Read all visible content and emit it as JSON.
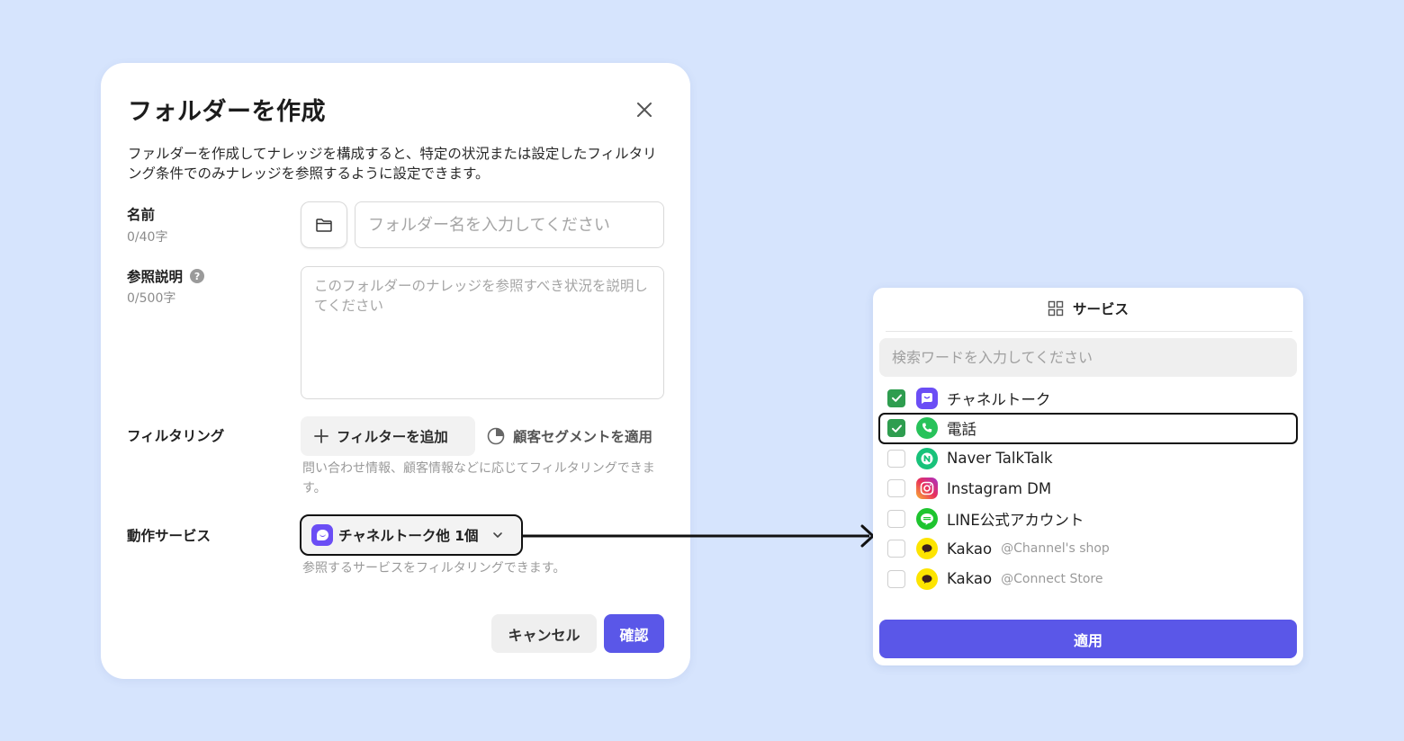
{
  "modal": {
    "title": "フォルダーを作成",
    "description": "ファルダーを作成してナレッジを構成すると、特定の状況または設定したフィルタリング条件でのみナレッジを参照するように設定できます。",
    "name_label": "名前",
    "name_count": "0/40字",
    "name_placeholder": "フォルダー名を入力してください",
    "ref_label": "参照説明",
    "ref_count": "0/500字",
    "ref_placeholder": "このフォルダーのナレッジを参照すべき状況を説明してください",
    "filter_label": "フィルタリング",
    "add_filter": "フィルターを追加",
    "apply_segment": "顧客セグメントを適用",
    "filter_hint": "問い合わせ情報、顧客情報などに応じてフィルタリングできます。",
    "service_label": "動作サービス",
    "service_value": "チャネルトーク他 1個",
    "service_hint": "参照するサービスをフィルタリングできます。",
    "cancel": "キャンセル",
    "confirm": "確認"
  },
  "panel": {
    "title": "サービス",
    "search_placeholder": "検索ワードを入力してください",
    "items": [
      {
        "name": "チャネルトーク",
        "sub": "",
        "checked": true,
        "icon": "channel-talk-icon"
      },
      {
        "name": "電話",
        "sub": "",
        "checked": true,
        "icon": "phone-icon"
      },
      {
        "name": "Naver TalkTalk",
        "sub": "",
        "checked": false,
        "icon": "naver-talktalk-icon"
      },
      {
        "name": "Instagram DM",
        "sub": "",
        "checked": false,
        "icon": "instagram-icon"
      },
      {
        "name": "LINE公式アカウント",
        "sub": "",
        "checked": false,
        "icon": "line-icon"
      },
      {
        "name": "Kakao",
        "sub": "@Channel's shop",
        "checked": false,
        "icon": "kakao-icon"
      },
      {
        "name": "Kakao",
        "sub": "@Connect Store",
        "checked": false,
        "icon": "kakao-icon"
      }
    ],
    "apply": "適用"
  },
  "colors": {
    "background": "#d6e4fd",
    "accent": "#5a57e8",
    "checkbox_on": "#2e9d4f"
  }
}
